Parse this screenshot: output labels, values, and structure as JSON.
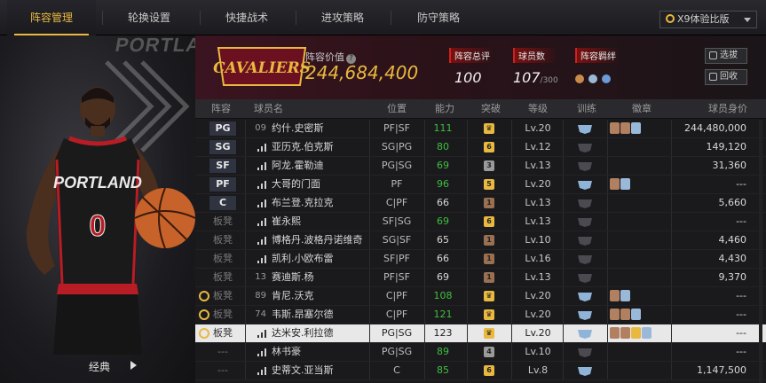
{
  "nav": {
    "tabs": [
      "阵容管理",
      "轮换设置",
      "快捷战术",
      "进攻策略",
      "防守策略"
    ],
    "active_index": 0,
    "version_select": "X9体验比版"
  },
  "left_panel": {
    "team_text": "PORTLAND",
    "bottom_label": "经典"
  },
  "header": {
    "team_logo_text": "CAVALIERS",
    "value_label": "阵容价值",
    "value": "244,684,400",
    "stats": [
      {
        "label": "阵容总评",
        "value": "100",
        "suffix": ""
      },
      {
        "label": "球员数",
        "value": "107",
        "suffix": "/300"
      },
      {
        "label": "阵容羁绊",
        "value": "",
        "suffix": ""
      }
    ],
    "buttons": [
      "选拔",
      "回收"
    ]
  },
  "table": {
    "headers": [
      "阵容",
      "球员名",
      "位置",
      "能力",
      "突破",
      "等级",
      "训练",
      "徽章",
      "球员身价"
    ],
    "rows": [
      {
        "slot": "PG",
        "bench": false,
        "alarm": false,
        "jersey": "09",
        "name": "约什.史密斯",
        "pos": "PF|SF",
        "ovr": "111",
        "green": true,
        "brk": "♛",
        "brkc": "#e9b83f",
        "lv": "Lv.20",
        "train": true,
        "badges": [
          "#b08060",
          "#b08060",
          "#9ab8d8"
        ],
        "salary": "244,480,000"
      },
      {
        "slot": "SG",
        "bench": false,
        "alarm": false,
        "jersey": "",
        "name": "亚历克.伯克斯",
        "pos": "SG|PG",
        "ovr": "80",
        "green": true,
        "brk": "6",
        "brkc": "#e9b83f",
        "lv": "Lv.12",
        "train": false,
        "badges": [],
        "salary": "149,120"
      },
      {
        "slot": "SF",
        "bench": false,
        "alarm": false,
        "jersey": "",
        "name": "阿龙.霍勒迪",
        "pos": "PG|SG",
        "ovr": "69",
        "green": true,
        "brk": "3",
        "brkc": "#9a9a9a",
        "lv": "Lv.13",
        "train": false,
        "badges": [],
        "salary": "31,360"
      },
      {
        "slot": "PF",
        "bench": false,
        "alarm": false,
        "jersey": "",
        "name": "大哥的门面",
        "pos": "PF",
        "ovr": "96",
        "green": true,
        "brk": "5",
        "brkc": "#e9b83f",
        "lv": "Lv.20",
        "train": true,
        "badges": [
          "#b08060",
          "#9ab8d8"
        ],
        "salary": "---"
      },
      {
        "slot": "C",
        "bench": false,
        "alarm": false,
        "jersey": "",
        "name": "布兰登.克拉克",
        "pos": "C|PF",
        "ovr": "66",
        "green": false,
        "brk": "1",
        "brkc": "#9a7050",
        "lv": "Lv.13",
        "train": false,
        "badges": [],
        "salary": "5,660"
      },
      {
        "slot": "板凳",
        "bench": true,
        "alarm": false,
        "jersey": "",
        "name": "崔永熙",
        "pos": "SF|SG",
        "ovr": "69",
        "green": true,
        "brk": "6",
        "brkc": "#e9b83f",
        "lv": "Lv.13",
        "train": false,
        "badges": [],
        "salary": "---"
      },
      {
        "slot": "板凳",
        "bench": true,
        "alarm": false,
        "jersey": "",
        "name": "博格丹.波格丹诺维奇",
        "pos": "SG|SF",
        "ovr": "65",
        "green": false,
        "brk": "1",
        "brkc": "#9a7050",
        "lv": "Lv.10",
        "train": false,
        "badges": [],
        "salary": "4,460"
      },
      {
        "slot": "板凳",
        "bench": true,
        "alarm": false,
        "jersey": "",
        "name": "凯利.小欧布雷",
        "pos": "SF|PF",
        "ovr": "66",
        "green": false,
        "brk": "1",
        "brkc": "#9a7050",
        "lv": "Lv.16",
        "train": false,
        "badges": [],
        "salary": "4,430"
      },
      {
        "slot": "板凳",
        "bench": true,
        "alarm": false,
        "jersey": "13",
        "name": "赛迪斯.杨",
        "pos": "PF|SF",
        "ovr": "69",
        "green": false,
        "brk": "1",
        "brkc": "#9a7050",
        "lv": "Lv.13",
        "train": false,
        "badges": [],
        "salary": "9,370"
      },
      {
        "slot": "板凳",
        "bench": true,
        "alarm": true,
        "jersey": "89",
        "name": "肯尼.沃克",
        "pos": "C|PF",
        "ovr": "108",
        "green": true,
        "brk": "♛",
        "brkc": "#e9b83f",
        "lv": "Lv.20",
        "train": true,
        "badges": [
          "#b08060",
          "#9ab8d8"
        ],
        "salary": "---"
      },
      {
        "slot": "板凳",
        "bench": true,
        "alarm": true,
        "jersey": "74",
        "name": "韦斯.昂塞尔德",
        "pos": "C|PF",
        "ovr": "121",
        "green": true,
        "brk": "♛",
        "brkc": "#e9b83f",
        "lv": "Lv.20",
        "train": true,
        "badges": [
          "#b08060",
          "#b08060",
          "#9ab8d8"
        ],
        "salary": "---"
      },
      {
        "slot": "板凳",
        "bench": true,
        "alarm": true,
        "jersey": "",
        "name": "达米安.利拉德",
        "pos": "PG|SG",
        "ovr": "123",
        "green": false,
        "brk": "♛",
        "brkc": "#e9b83f",
        "lv": "Lv.20",
        "train": true,
        "badges": [
          "#b08060",
          "#b08060",
          "#e9b83f",
          "#9ab8d8"
        ],
        "salary": "---",
        "selected": true
      },
      {
        "slot": "---",
        "bench": true,
        "alarm": false,
        "jersey": "",
        "name": "林书豪",
        "pos": "PG|SG",
        "ovr": "89",
        "green": true,
        "brk": "4",
        "brkc": "#9a9a9a",
        "lv": "Lv.10",
        "train": false,
        "badges": [],
        "salary": "---"
      },
      {
        "slot": "---",
        "bench": true,
        "alarm": false,
        "jersey": "",
        "name": "史蒂文.亚当斯",
        "pos": "C",
        "ovr": "85",
        "green": true,
        "brk": "6",
        "brkc": "#e9b83f",
        "lv": "Lv.8",
        "train": true,
        "badges": [],
        "salary": "1,147,500"
      }
    ]
  }
}
